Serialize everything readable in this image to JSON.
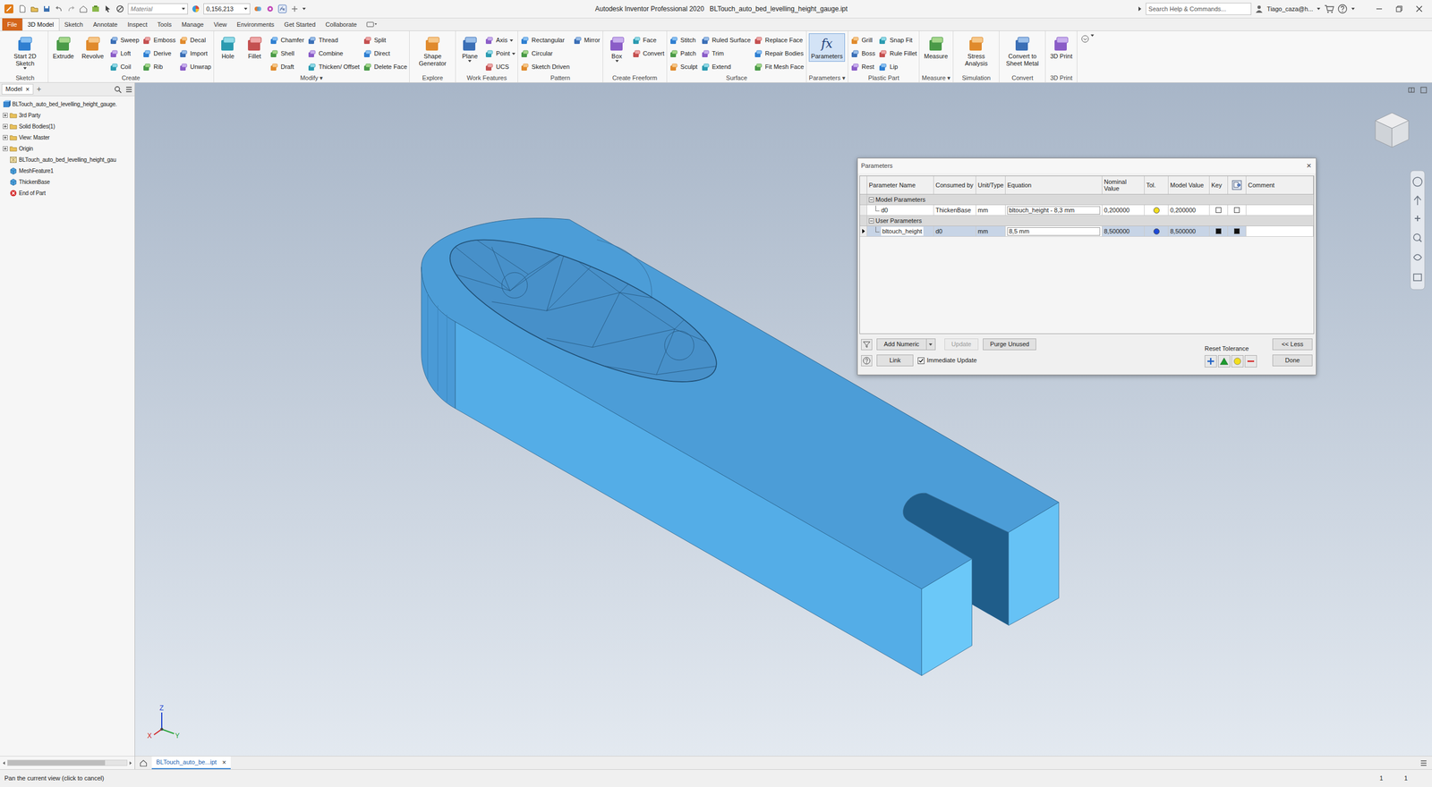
{
  "window": {
    "title": "Autodesk Inventor Professional 2020",
    "document": "BLTouch_auto_bed_levelling_height_gauge.ipt"
  },
  "quick_access": {
    "material": "Material",
    "appearance": "0,156,213"
  },
  "help_search": {
    "placeholder": "Search Help & Commands..."
  },
  "user": {
    "name": "Tiago_caza@h..."
  },
  "ribbon_tabs": [
    {
      "label": "File",
      "kind": "app-menu",
      "selected": false
    },
    {
      "label": "3D Model",
      "kind": "tab",
      "selected": true
    },
    {
      "label": "Sketch",
      "kind": "tab",
      "selected": false
    },
    {
      "label": "Annotate",
      "kind": "tab",
      "selected": false
    },
    {
      "label": "Inspect",
      "kind": "tab",
      "selected": false
    },
    {
      "label": "Tools",
      "kind": "tab",
      "selected": false
    },
    {
      "label": "Manage",
      "kind": "tab",
      "selected": false
    },
    {
      "label": "View",
      "kind": "tab",
      "selected": false
    },
    {
      "label": "Environments",
      "kind": "tab",
      "selected": false
    },
    {
      "label": "Get Started",
      "kind": "tab",
      "selected": false
    },
    {
      "label": "Collaborate",
      "kind": "tab",
      "selected": false
    }
  ],
  "ribbon_groups": [
    {
      "label": "Sketch",
      "columns": [
        {
          "kind": "large",
          "items": [
            {
              "label": "Start 2D Sketch",
              "menu": true
            }
          ]
        }
      ]
    },
    {
      "label": "Create",
      "columns": [
        {
          "kind": "large",
          "items": [
            {
              "label": "Extrude"
            }
          ]
        },
        {
          "kind": "large",
          "items": [
            {
              "label": "Revolve"
            }
          ]
        },
        {
          "kind": "small",
          "items": [
            {
              "label": "Sweep"
            },
            {
              "label": "Loft"
            },
            {
              "label": "Coil"
            }
          ]
        },
        {
          "kind": "small",
          "items": [
            {
              "label": "Emboss"
            },
            {
              "label": "Derive"
            },
            {
              "label": "Rib"
            }
          ]
        },
        {
          "kind": "small",
          "items": [
            {
              "label": "Decal"
            },
            {
              "label": "Import"
            },
            {
              "label": "Unwrap"
            }
          ]
        }
      ]
    },
    {
      "label": "Modify ▾",
      "columns": [
        {
          "kind": "large",
          "items": [
            {
              "label": "Hole"
            }
          ]
        },
        {
          "kind": "large",
          "items": [
            {
              "label": "Fillet"
            }
          ]
        },
        {
          "kind": "small",
          "items": [
            {
              "label": "Chamfer"
            },
            {
              "label": "Shell"
            },
            {
              "label": "Draft"
            }
          ]
        },
        {
          "kind": "small",
          "items": [
            {
              "label": "Thread"
            },
            {
              "label": "Combine"
            },
            {
              "label": "Thicken/ Offset"
            }
          ]
        },
        {
          "kind": "small",
          "items": [
            {
              "label": "Split"
            },
            {
              "label": "Direct"
            },
            {
              "label": "Delete Face"
            }
          ]
        }
      ]
    },
    {
      "label": "Explore",
      "columns": [
        {
          "kind": "large",
          "items": [
            {
              "label": "Shape Generator"
            }
          ]
        }
      ]
    },
    {
      "label": "Work Features",
      "columns": [
        {
          "kind": "large",
          "items": [
            {
              "label": "Plane",
              "menu": true
            }
          ]
        },
        {
          "kind": "small",
          "items": [
            {
              "label": "Axis",
              "menu": true
            },
            {
              "label": "Point",
              "menu": true
            },
            {
              "label": "UCS"
            }
          ]
        }
      ]
    },
    {
      "label": "Pattern",
      "columns": [
        {
          "kind": "small",
          "items": [
            {
              "label": "Rectangular"
            },
            {
              "label": "Circular"
            },
            {
              "label": "Sketch Driven"
            }
          ]
        },
        {
          "kind": "small",
          "items": [
            {
              "label": "Mirror"
            }
          ]
        }
      ]
    },
    {
      "label": "Create Freeform",
      "columns": [
        {
          "kind": "large",
          "items": [
            {
              "label": "Box",
              "menu": true
            }
          ]
        },
        {
          "kind": "small",
          "items": [
            {
              "label": "Face"
            },
            {
              "label": "Convert"
            }
          ]
        }
      ]
    },
    {
      "label": "Surface",
      "columns": [
        {
          "kind": "small",
          "items": [
            {
              "label": "Stitch"
            },
            {
              "label": "Patch"
            },
            {
              "label": "Sculpt"
            }
          ]
        },
        {
          "kind": "small",
          "items": [
            {
              "label": "Ruled Surface"
            },
            {
              "label": "Trim"
            },
            {
              "label": "Extend"
            }
          ]
        },
        {
          "kind": "small",
          "items": [
            {
              "label": "Replace Face"
            },
            {
              "label": "Repair Bodies"
            },
            {
              "label": "Fit Mesh Face"
            }
          ]
        }
      ]
    },
    {
      "label": "Parameters ▾",
      "columns": [
        {
          "kind": "large",
          "items": [
            {
              "label": "Parameters",
              "glyph": "fx",
              "active": true
            }
          ]
        }
      ]
    },
    {
      "label": "Plastic Part",
      "columns": [
        {
          "kind": "small",
          "items": [
            {
              "label": "Grill"
            },
            {
              "label": "Boss"
            },
            {
              "label": "Rest"
            }
          ]
        },
        {
          "kind": "small",
          "items": [
            {
              "label": "Snap Fit"
            },
            {
              "label": "Rule Fillet"
            },
            {
              "label": "Lip"
            }
          ]
        }
      ]
    },
    {
      "label": "Measure ▾",
      "columns": [
        {
          "kind": "large",
          "items": [
            {
              "label": "Measure"
            }
          ]
        }
      ]
    },
    {
      "label": "Simulation",
      "columns": [
        {
          "kind": "large",
          "items": [
            {
              "label": "Stress Analysis"
            }
          ]
        }
      ]
    },
    {
      "label": "Convert",
      "columns": [
        {
          "kind": "large",
          "items": [
            {
              "label": "Convert to Sheet Metal"
            }
          ]
        }
      ]
    },
    {
      "label": "3D Print",
      "columns": [
        {
          "kind": "large",
          "items": [
            {
              "label": "3D Print"
            }
          ]
        }
      ]
    }
  ],
  "browser": {
    "tab": {
      "label": "Model",
      "close": "×",
      "selected": true
    },
    "add": "+",
    "items": [
      {
        "label": "BLTouch_auto_bed_levelling_height_gauge.",
        "kind": "part",
        "expandable": false,
        "expanded": false
      },
      {
        "label": "3rd Party",
        "kind": "folder",
        "expandable": true,
        "expanded": false
      },
      {
        "label": "Solid Bodies(1)",
        "kind": "folder",
        "expandable": true,
        "expanded": false
      },
      {
        "label": "View: Master",
        "kind": "folder",
        "expandable": true,
        "expanded": false
      },
      {
        "label": "Origin",
        "kind": "folder",
        "expandable": true,
        "expanded": false
      },
      {
        "label": "BLTouch_auto_bed_levelling_height_gau",
        "kind": "mesh",
        "expandable": false,
        "expanded": false
      },
      {
        "label": "MeshFeature1",
        "kind": "feature",
        "expandable": false,
        "expanded": false
      },
      {
        "label": "ThickenBase",
        "kind": "feature",
        "expandable": false,
        "expanded": false
      },
      {
        "label": "End of Part",
        "kind": "end",
        "expandable": false,
        "expanded": false
      }
    ],
    "scrollbar": {
      "level": 0.82
    }
  },
  "parameters_dialog": {
    "title": "Parameters",
    "close": "×",
    "columns": [
      {
        "label": "Parameter Name",
        "kind": "text"
      },
      {
        "label": "Consumed by",
        "kind": "text"
      },
      {
        "label": "Unit/Type",
        "kind": "text"
      },
      {
        "label": "Equation",
        "kind": "text"
      },
      {
        "label": "Nominal Value",
        "kind": "text"
      },
      {
        "label": "Tol.",
        "kind": "text"
      },
      {
        "label": "Model Value",
        "kind": "text"
      },
      {
        "label": "Key",
        "kind": "text"
      },
      {
        "kind": "icon"
      },
      {
        "label": "Comment",
        "kind": "text"
      }
    ],
    "groups": [
      {
        "label": "Model Parameters",
        "expanded": true,
        "rows": [
          {
            "name": "d0",
            "consumed_by": "ThickenBase",
            "unit": "mm",
            "equation": "bltouch_height - 8,3 mm",
            "nominal": "0,200000",
            "tol_color": "#f2de1e",
            "model": "0,200000",
            "key": false,
            "export": false,
            "comment": "",
            "selected": false
          }
        ]
      },
      {
        "label": "User Parameters",
        "expanded": true,
        "rows": [
          {
            "name": "bltouch_height",
            "consumed_by": "d0",
            "unit": "mm",
            "equation": "8,5 mm",
            "nominal": "8,500000",
            "tol_color": "#1c48d6",
            "model": "8,500000",
            "key": true,
            "export": true,
            "comment": "",
            "selected": true
          }
        ]
      }
    ],
    "add_numeric": "Add Numeric",
    "update": {
      "label": "Update",
      "disabled": true
    },
    "purge": "Purge Unused",
    "link": "Link",
    "immediate_update": {
      "label": "Immediate Update",
      "checked": true
    },
    "reset_tolerance": {
      "label": "Reset Tolerance",
      "buttons": [
        {
          "kind": "plus",
          "color": "#1c5fc4"
        },
        {
          "kind": "triangle",
          "color": "#1d9a2f"
        },
        {
          "kind": "circle",
          "color": "#f2de1e"
        },
        {
          "kind": "minus",
          "color": "#d42020"
        }
      ]
    },
    "less": "<< Less",
    "done": "Done"
  },
  "triad": {
    "z": "Z",
    "x": "X",
    "y": "Y"
  },
  "document_tabs": [
    {
      "label": "BLTouch_auto_be...ipt",
      "close": "×",
      "selected": true
    }
  ],
  "status_bar": {
    "message": "Pan the current view (click to cancel)",
    "counts": [
      "1",
      "1"
    ]
  }
}
